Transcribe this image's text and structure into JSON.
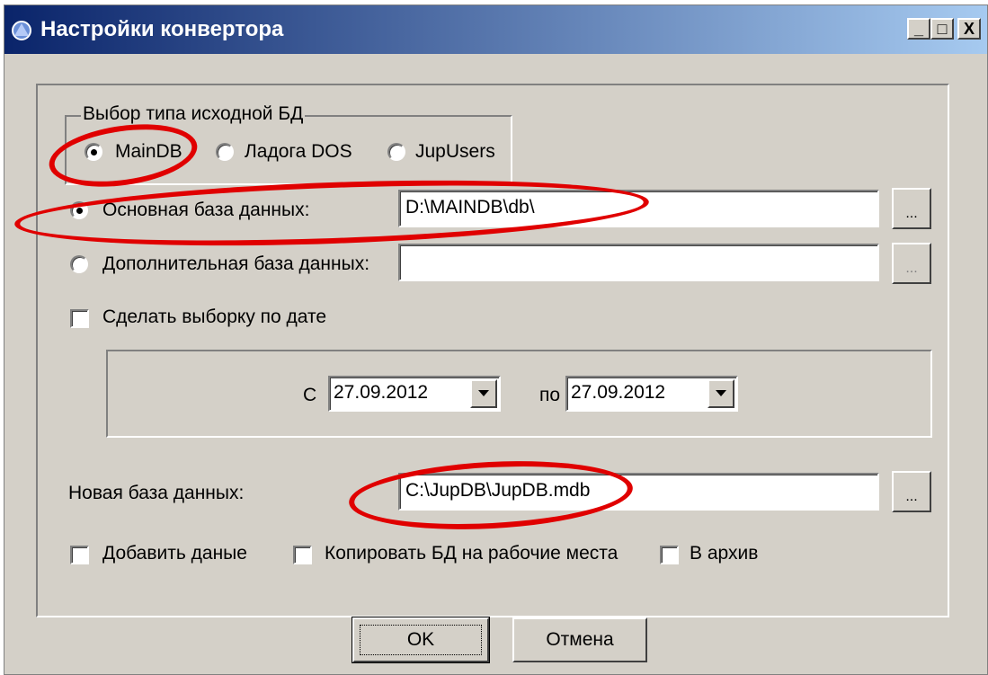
{
  "window": {
    "title": "Настройки конвертора",
    "controls": {
      "minimize": "_",
      "maximize": "□",
      "close": "X"
    }
  },
  "source_group": {
    "title": "Выбор типа исходной БД",
    "options": [
      {
        "label": "MainDB",
        "selected": true
      },
      {
        "label": "Ладога DOS",
        "selected": false
      },
      {
        "label": "JupUsers",
        "selected": false
      }
    ]
  },
  "main_db": {
    "label": "Основная база данных:",
    "value": "D:\\MAINDB\\db\\",
    "selected": true,
    "browse_label": "..."
  },
  "extra_db": {
    "label": "Дополнительная база данных:",
    "value": "",
    "selected": false,
    "browse_label": "..."
  },
  "date_filter": {
    "label": "Сделать выборку по дате",
    "checked": false,
    "from_label": "С",
    "from_value": "27.09.2012",
    "to_label": "по",
    "to_value": "27.09.2012"
  },
  "new_db": {
    "label": "Новая база данных:",
    "value": "C:\\JupDB\\JupDB.mdb",
    "browse_label": "..."
  },
  "options": [
    {
      "label": "Добавить даные",
      "checked": false
    },
    {
      "label": "Копировать БД на рабочие места",
      "checked": false
    },
    {
      "label": "В архив",
      "checked": false
    }
  ],
  "buttons": {
    "ok": "OK",
    "cancel": "Отмена"
  },
  "annotation_color": "#e00000"
}
